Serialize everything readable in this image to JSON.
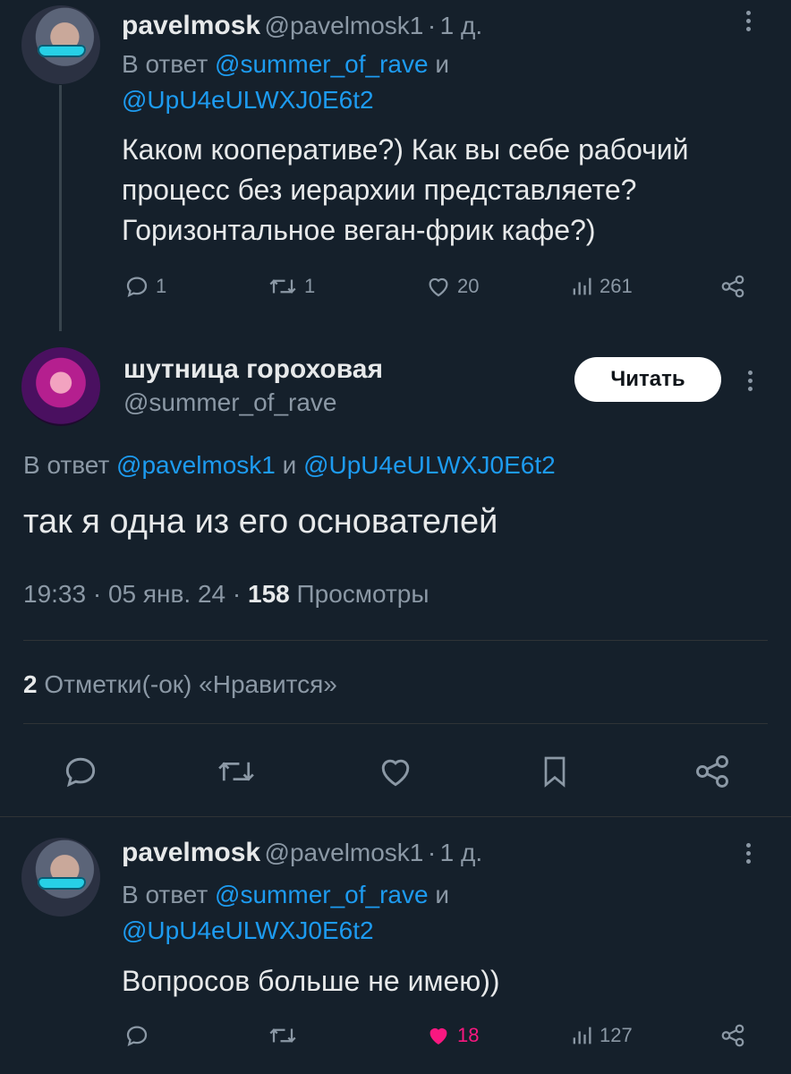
{
  "tweet1": {
    "name": "pavelmosk",
    "handle": "@pavelmosk1",
    "dot": "·",
    "time": "1 д.",
    "reply_prefix": "В ответ",
    "reply_user1": "@summer_of_rave",
    "reply_and": "и",
    "reply_user2": "@UpU4eULWXJ0E6t2",
    "text_line1": "Каком кооперативе?) Как вы себе рабочий",
    "text_line2": "процесс без иерархии представляете?",
    "text_line3": "Горизонтальное веган-фрик кафе?)",
    "replies": "1",
    "retweets": "1",
    "likes": "20",
    "views": "261"
  },
  "main_tweet": {
    "name": "шутница гороховая",
    "handle": "@summer_of_rave",
    "follow_label": "Читать",
    "reply_prefix": "В ответ",
    "reply_user1": "@pavelmosk1",
    "reply_and": "и",
    "reply_user2": "@UpU4eULWXJ0E6t2",
    "text": "так я одна из его основателей",
    "time": "19:33",
    "sep1": "·",
    "date": "05 янв. 24",
    "sep2": "·",
    "views_count": "158",
    "views_label": "Просмотры",
    "likes_count": "2",
    "likes_label": "Отметки(-ок) «Нравится»"
  },
  "tweet3": {
    "name": "pavelmosk",
    "handle": "@pavelmosk1",
    "dot": "·",
    "time": "1 д.",
    "reply_prefix": "В ответ",
    "reply_user1": "@summer_of_rave",
    "reply_and": "и",
    "reply_user2": "@UpU4eULWXJ0E6t2",
    "text": "Вопросов больше не имею))",
    "likes": "18",
    "views": "127"
  },
  "colors": {
    "background": "#15202b",
    "text": "#e7e9ea",
    "muted": "#8b98a5",
    "link": "#1d9bf0",
    "liked": "#f91880"
  },
  "icons": [
    "reply-icon",
    "retweet-icon",
    "heart-icon",
    "views-icon",
    "share-icon",
    "bookmark-icon",
    "more-icon"
  ]
}
